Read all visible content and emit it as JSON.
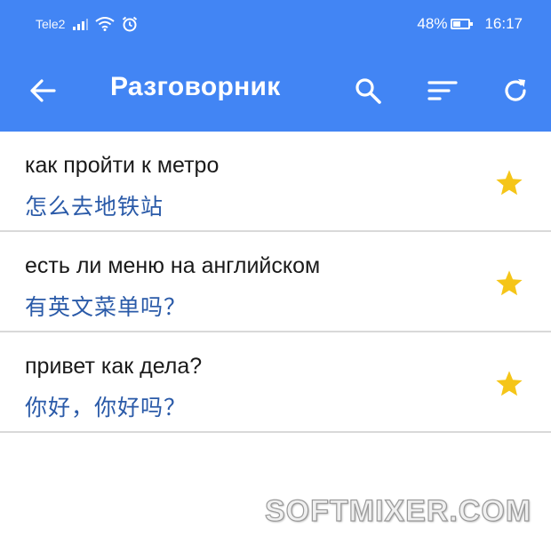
{
  "status_bar": {
    "carrier": "Tele2",
    "battery_percent": "48%",
    "battery_level": 0.48,
    "time": "16:17",
    "icons": [
      "signal-icon",
      "wifi-icon",
      "alarm-icon",
      "battery-icon"
    ]
  },
  "toolbar": {
    "title": "Разговорник",
    "icons": [
      "back-arrow-icon",
      "search-icon",
      "sort-icon",
      "refresh-icon"
    ]
  },
  "phrases": [
    {
      "source": "как пройти к метро",
      "translation": "怎么去地铁站",
      "favorite": true
    },
    {
      "source": "есть ли меню на английском",
      "translation": "有英文菜单吗？",
      "favorite": true
    },
    {
      "source": "привет как дела?",
      "translation": "你好，你好吗？",
      "favorite": true
    }
  ],
  "watermark": "SOFTMIXER.COM",
  "colors": {
    "primary": "#4285f4",
    "translation_text": "#2a5aa8",
    "star": "#f5c518",
    "divider": "#d9d9d9"
  }
}
